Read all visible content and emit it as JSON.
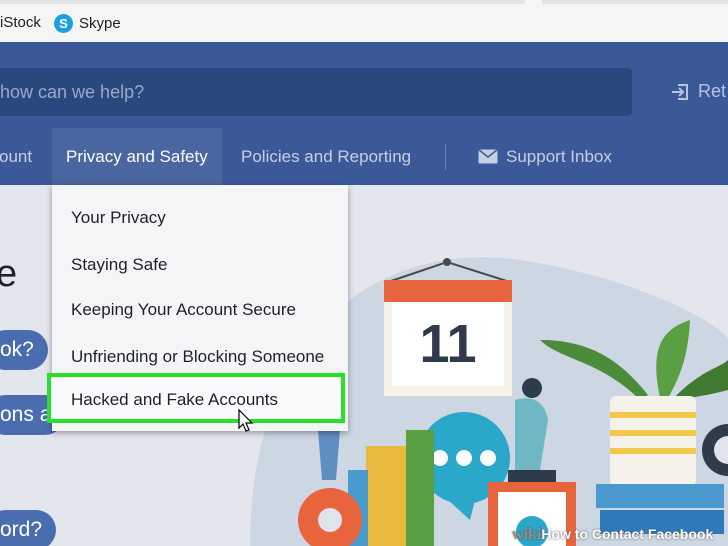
{
  "bookmarks": [
    {
      "label": "iStock",
      "icon": "bookmark-icon"
    },
    {
      "label": "Skype",
      "icon": "skype-icon"
    }
  ],
  "header": {
    "search_placeholder": "how can we help?",
    "login_label": "Ret",
    "nav": {
      "account": "ount",
      "privacy": "Privacy and Safety",
      "policies": "Policies and Reporting",
      "inbox": "Support Inbox"
    }
  },
  "dropdown": {
    "items": [
      "Your Privacy",
      "Staying Safe",
      "Keeping Your Account Secure",
      "Unfriending or Blocking Someone",
      "Hacked and Fake Accounts"
    ]
  },
  "body": {
    "big_letter": "e",
    "pill1": "ok?",
    "pill2": "ons a",
    "pill3": "ord?",
    "calendar_number": "11"
  },
  "watermark": {
    "brand": "wiki",
    "title": "How to Contact Facebook"
  },
  "colors": {
    "header": "#3b5998",
    "highlight": "#28e028",
    "calendar": "#e8643c"
  }
}
